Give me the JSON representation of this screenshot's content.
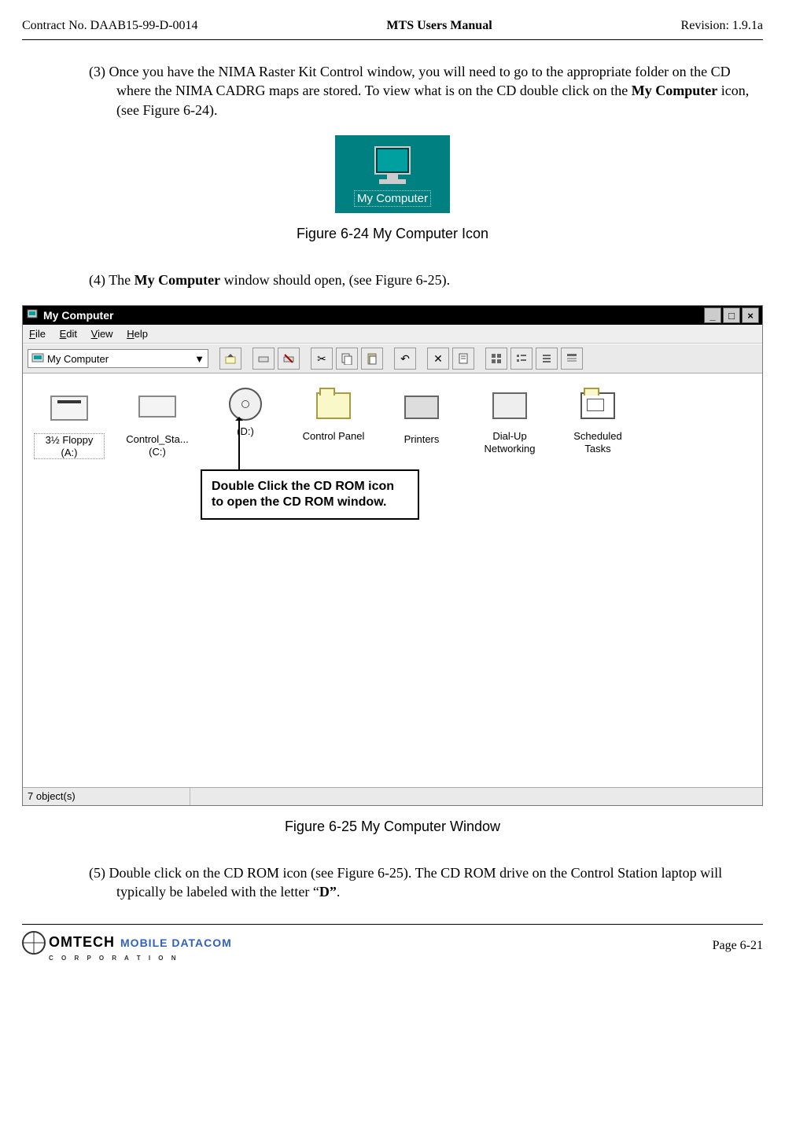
{
  "header": {
    "contract": "Contract No. DAAB15-99-D-0014",
    "title": "MTS Users Manual",
    "revision": "Revision:  1.9.1a"
  },
  "para3": {
    "num": "(3)",
    "text_a": "Once you have the NIMA Raster Kit Control window, you will need to go to the appropriate folder on the CD where the NIMA CADRG maps are stored.  To view what is on the CD double click on the ",
    "bold_a": "My Computer",
    "text_b": " icon, (see Figure 6-24)."
  },
  "desktop_icon_label": "My Computer",
  "caption_24": "Figure 6-24   My Computer Icon",
  "para4": {
    "num": "(4)",
    "text_a": "The ",
    "bold_a": "My Computer",
    "text_b": " window should open, (see Figure 6-25)."
  },
  "win": {
    "title": "My Computer",
    "menu": {
      "file": "File",
      "edit": "Edit",
      "view": "View",
      "help": "Help"
    },
    "address": "My Computer",
    "items": {
      "floppy": "3½ Floppy (A:)",
      "c": "Control_Sta... (C:)",
      "d": "(D:)",
      "cp": "Control Panel",
      "pr": "Printers",
      "dun1": "Dial-Up",
      "dun2": "Networking",
      "st1": "Scheduled",
      "st2": "Tasks"
    },
    "status": "7 object(s)"
  },
  "callout": "Double Click the CD ROM icon to open the CD ROM window.",
  "caption_25": "Figure 6-25   My Computer Window",
  "para5": {
    "num": "(5)",
    "text_a": "Double click on the CD ROM icon (see Figure 6-25).  The CD ROM drive on the Control Station laptop will typically be labeled with the letter “",
    "bold_a": "D”",
    "text_b": "."
  },
  "footer": {
    "logo_main": "OMTECH",
    "logo_sub": "MOBILE DATACOM",
    "logo_corp": "C O R P O R A T I O N",
    "page": "Page 6-21"
  }
}
